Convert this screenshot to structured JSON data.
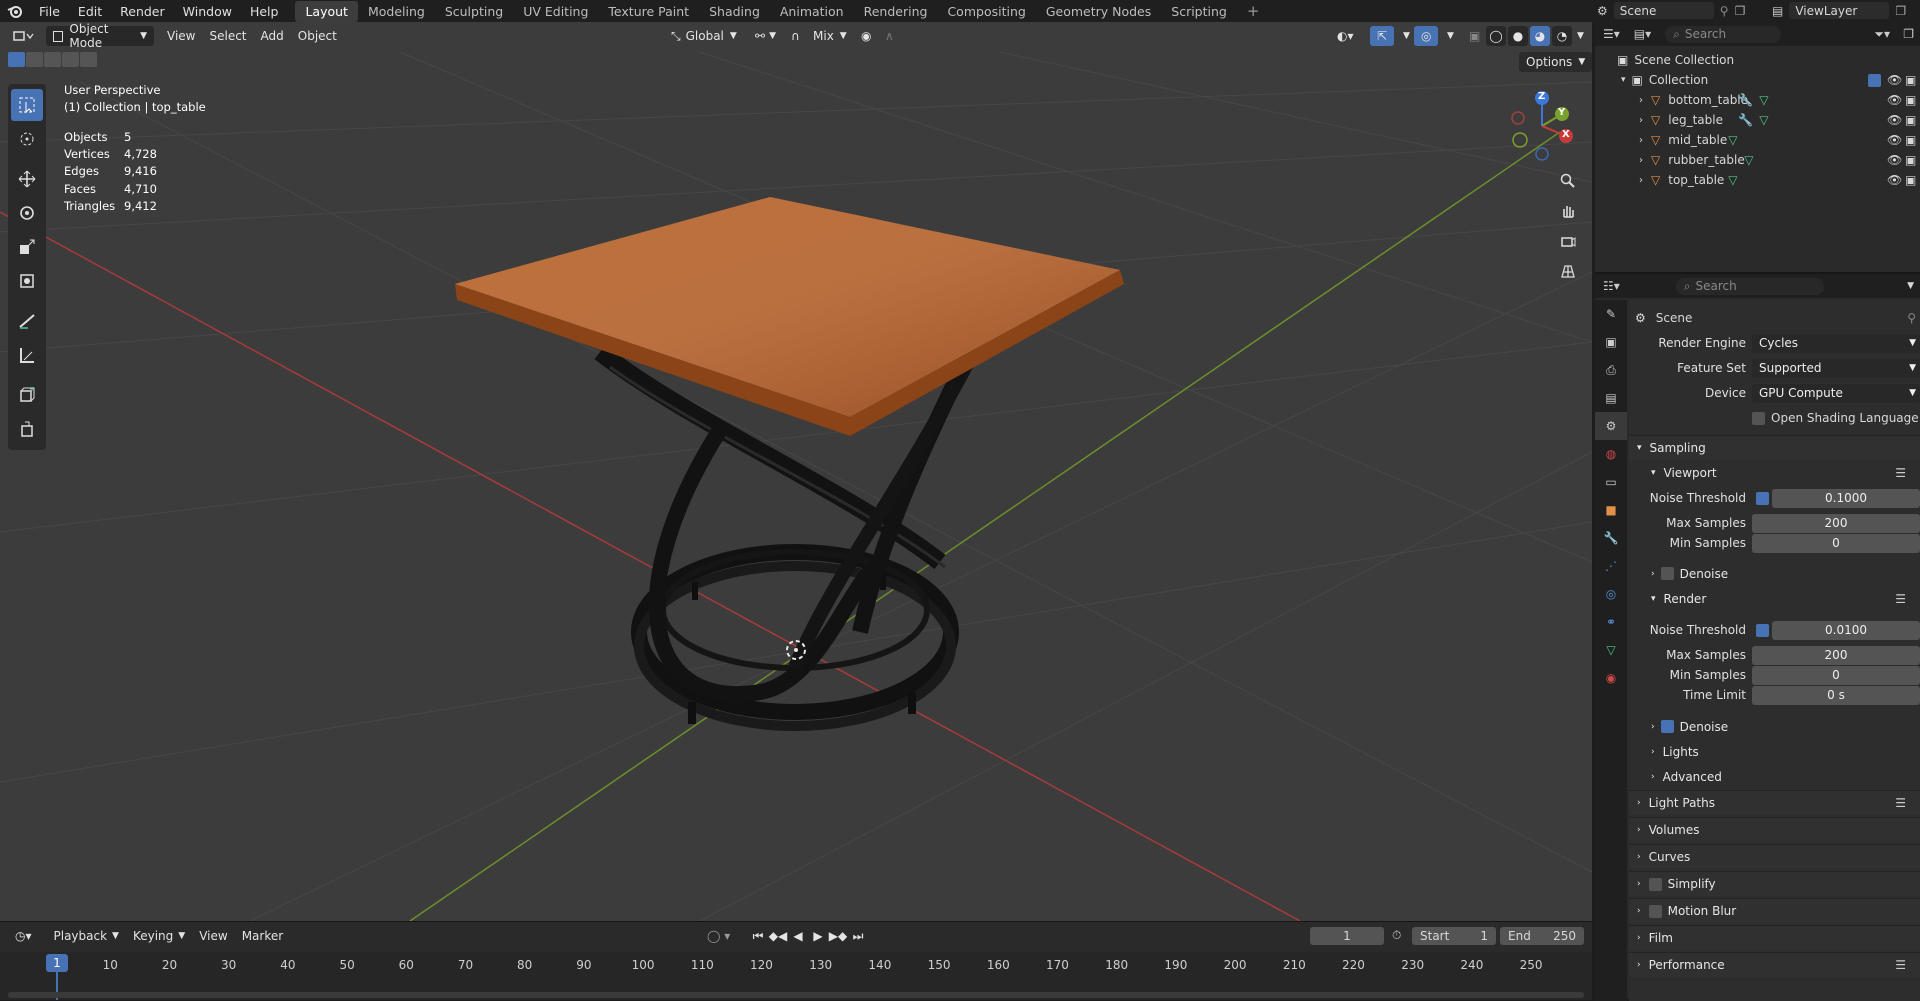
{
  "topbar": {
    "menu": [
      "File",
      "Edit",
      "Render",
      "Window",
      "Help"
    ],
    "workspaces": [
      "Layout",
      "Modeling",
      "Sculpting",
      "UV Editing",
      "Texture Paint",
      "Shading",
      "Animation",
      "Rendering",
      "Compositing",
      "Geometry Nodes",
      "Scripting"
    ],
    "active_workspace": "Layout",
    "scene": "Scene",
    "view_layer": "ViewLayer"
  },
  "viewport": {
    "mode": "Object Mode",
    "menus": [
      "View",
      "Select",
      "Add",
      "Object"
    ],
    "transform_orientation": "Global",
    "snap_mode": "Mix",
    "options_label": "Options",
    "overlay_title": "User Perspective",
    "overlay_subtitle": "(1) Collection | top_table",
    "stats": [
      {
        "label": "Objects",
        "value": "5"
      },
      {
        "label": "Vertices",
        "value": "4,728"
      },
      {
        "label": "Edges",
        "value": "9,416"
      },
      {
        "label": "Faces",
        "value": "4,710"
      },
      {
        "label": "Triangles",
        "value": "9,412"
      }
    ],
    "gizmo_axes": {
      "x": "X",
      "y": "Y",
      "z": "Z"
    }
  },
  "timeline": {
    "menus": [
      "Playback",
      "Keying",
      "View",
      "Marker"
    ],
    "current_frame": "1",
    "start_label": "Start",
    "start": "1",
    "end_label": "End",
    "end": "250",
    "ticks": [
      "1",
      "10",
      "20",
      "30",
      "40",
      "50",
      "60",
      "70",
      "80",
      "90",
      "100",
      "110",
      "120",
      "130",
      "140",
      "150",
      "160",
      "170",
      "180",
      "190",
      "200",
      "210",
      "220",
      "230",
      "240",
      "250"
    ]
  },
  "outliner": {
    "search_placeholder": "Search",
    "scene_collection": "Scene Collection",
    "collection": "Collection",
    "objects": [
      "bottom_table",
      "leg_table",
      "mid_table",
      "rubber_table",
      "top_table"
    ]
  },
  "properties": {
    "search_placeholder": "Search",
    "context": "Scene",
    "render_engine_label": "Render Engine",
    "render_engine": "Cycles",
    "feature_set_label": "Feature Set",
    "feature_set": "Supported",
    "device_label": "Device",
    "device": "GPU Compute",
    "osl_label": "Open Shading Language",
    "sampling": "Sampling",
    "viewport": "Viewport",
    "noise_threshold_label": "Noise Threshold",
    "vp_noise_threshold": "0.1000",
    "max_samples_label": "Max Samples",
    "vp_max_samples": "200",
    "min_samples_label": "Min Samples",
    "vp_min_samples": "0",
    "denoise_label": "Denoise",
    "render": "Render",
    "r_noise_threshold": "0.0100",
    "r_max_samples": "200",
    "r_min_samples": "0",
    "time_limit_label": "Time Limit",
    "r_time_limit": "0 s",
    "lights": "Lights",
    "advanced": "Advanced",
    "panels": [
      "Light Paths",
      "Volumes",
      "Curves",
      "Simplify",
      "Motion Blur",
      "Film",
      "Performance"
    ]
  },
  "colors": {
    "accent": "#4772b3",
    "wood": "#b0612a",
    "x_axis": "#c93a3a",
    "y_axis": "#7aa12c",
    "z_axis": "#3b78d8",
    "object_icon": "#e3904b",
    "mesh_icon": "#4fc38a"
  }
}
